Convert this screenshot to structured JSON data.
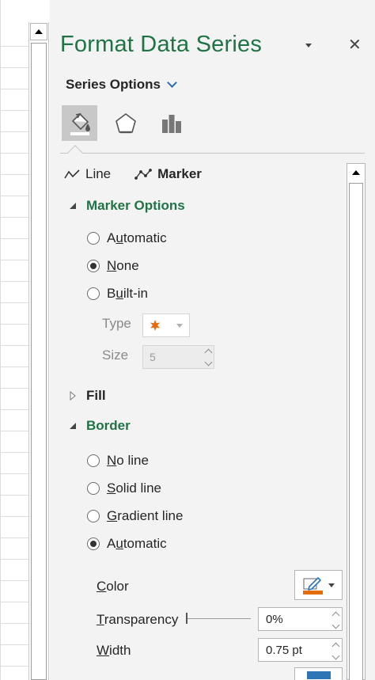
{
  "pane": {
    "title": "Format Data Series",
    "series_options": "Series Options",
    "tabs": [
      {
        "name": "fill-line-icon",
        "active": true
      },
      {
        "name": "effects-icon",
        "active": false
      },
      {
        "name": "series-options-icon",
        "active": false
      }
    ],
    "subtabs": {
      "line": "Line",
      "marker": "Marker"
    }
  },
  "marker_options": {
    "heading": "Marker Options",
    "radios": [
      {
        "pre": "A",
        "u": "u",
        "post": "tomatic",
        "checked": false
      },
      {
        "pre": "",
        "u": "N",
        "post": "one",
        "checked": true
      },
      {
        "pre": "B",
        "u": "u",
        "post": "ilt-in",
        "checked": false
      }
    ],
    "type_label": "Type",
    "size_label": "Size",
    "size_value": "5",
    "marker_color": "#e46c0a"
  },
  "fill": {
    "heading": "Fill"
  },
  "border": {
    "heading": "Border",
    "radios": [
      {
        "pre": "",
        "u": "N",
        "post": "o line",
        "checked": false
      },
      {
        "pre": "",
        "u": "S",
        "post": "olid line",
        "checked": false
      },
      {
        "pre": "",
        "u": "G",
        "post": "radient line",
        "checked": false
      },
      {
        "pre": "A",
        "u": "u",
        "post": "tomatic",
        "checked": true
      }
    ],
    "color": {
      "u": "C",
      "post": "olor"
    },
    "transparency": {
      "u": "T",
      "post": "ransparency",
      "value": "0%"
    },
    "width": {
      "u": "W",
      "post": "idth",
      "value": "0.75 pt"
    },
    "pen_color": "#e46c0a"
  },
  "colors": {
    "accent_green": "#217346",
    "pane_bg": "#f3f3f3"
  }
}
